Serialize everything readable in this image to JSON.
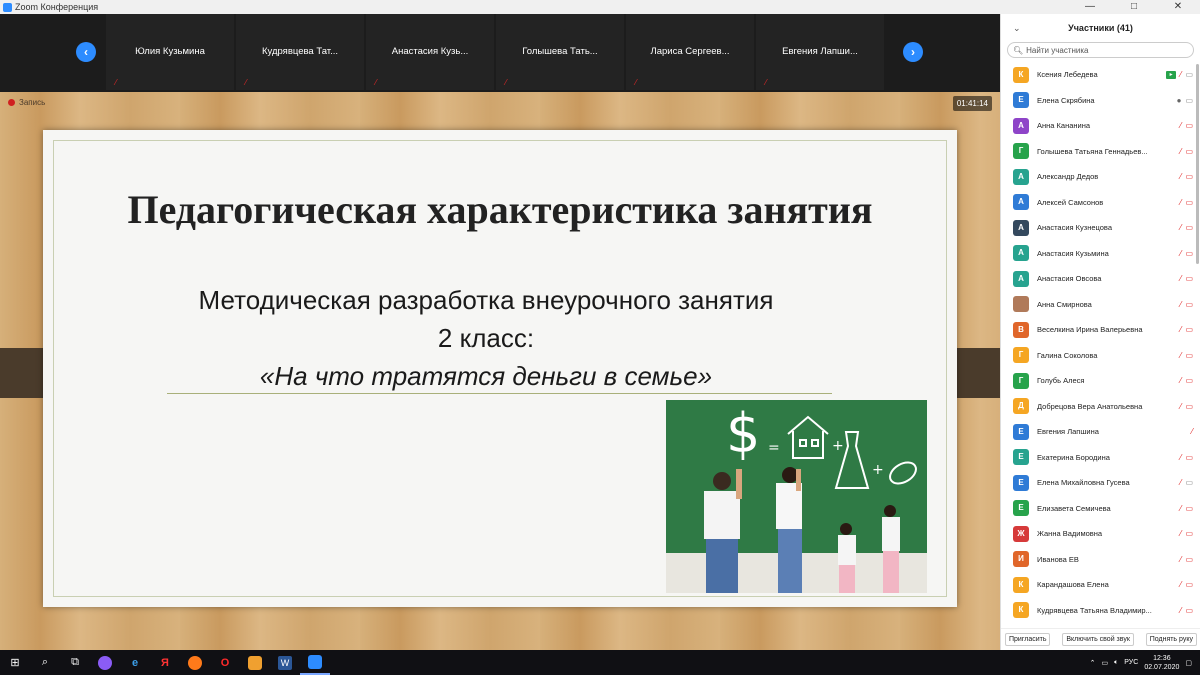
{
  "window": {
    "title": "Zoom Конференция",
    "controls": [
      "—",
      "□",
      "✕"
    ]
  },
  "strip": {
    "participants": [
      "Юлия Кузьмина",
      "Кудрявцева  Тат...",
      "Анастасия  Кузь...",
      "Голышева  Тать...",
      "Лариса  Сергеев...",
      "Евгения  Лапши..."
    ]
  },
  "share": {
    "recording_label": "Запись",
    "timer": "01:41:14"
  },
  "slide": {
    "title": "Педагогическая характеристика занятия",
    "line1": "Методическая разработка внеурочного  занятия",
    "line2": "2 класс:",
    "line3": "«На что тратятся  деньги в семье»"
  },
  "panel": {
    "title": "Участники (41)",
    "search_placeholder": "Найти участника",
    "participants": [
      {
        "initial": "К",
        "name": "Ксения Лебедева",
        "color": "#f5a623",
        "icons": "share-mic-cam"
      },
      {
        "initial": "Е",
        "name": "Елена Скрябина",
        "color": "#2f7bd6",
        "icons": "mic-cam"
      },
      {
        "initial": "А",
        "name": " Анна Кананина",
        "color": "#8e44c8",
        "icons": "off"
      },
      {
        "initial": "Г",
        "name": " Голышева Татьяна Геннадьев...",
        "color": "#27a34b",
        "icons": "off"
      },
      {
        "initial": "А",
        "name": "Александр Дедов",
        "color": "#27a38f",
        "icons": "off"
      },
      {
        "initial": "А",
        "name": "Алексей Самсонов",
        "color": "#2f7bd6",
        "icons": "off"
      },
      {
        "initial": "А",
        "name": "Анастасия Кузнецова",
        "color": "#34495e",
        "icons": "off"
      },
      {
        "initial": "А",
        "name": "Анастасия Кузьмина",
        "color": "#27a38f",
        "icons": "off"
      },
      {
        "initial": "А",
        "name": "Анастасия Овсова",
        "color": "#27a38f",
        "icons": "off"
      },
      {
        "initial": "",
        "name": "Анна Смирнова",
        "color": "#b07a5a",
        "icons": "off"
      },
      {
        "initial": "В",
        "name": "Веселкина Ирина Валерьевна",
        "color": "#e0662a",
        "icons": "off"
      },
      {
        "initial": "Г",
        "name": "Галина Соколова",
        "color": "#f5a623",
        "icons": "off"
      },
      {
        "initial": "Г",
        "name": "Голубь Алеся",
        "color": "#27a34b",
        "icons": "off"
      },
      {
        "initial": "Д",
        "name": "Добрецова Вера Анатольевна",
        "color": "#f5a623",
        "icons": "off"
      },
      {
        "initial": "Е",
        "name": "Евгения Лапшина",
        "color": "#2f7bd6",
        "icons": "mic-off"
      },
      {
        "initial": "Е",
        "name": "Екатерина Бородина",
        "color": "#27a38f",
        "icons": "off"
      },
      {
        "initial": "Е",
        "name": "Елена Михайловна Гусева",
        "color": "#2f7bd6",
        "icons": "mic-off-cam"
      },
      {
        "initial": "Е",
        "name": "Елизавета Семичева",
        "color": "#27a34b",
        "icons": "off"
      },
      {
        "initial": "Ж",
        "name": "Жанна Вадимовна",
        "color": "#d63a3a",
        "icons": "off"
      },
      {
        "initial": "И",
        "name": "Иванова ЕВ",
        "color": "#e0662a",
        "icons": "off"
      },
      {
        "initial": "К",
        "name": "Карандашова Елена",
        "color": "#f5a623",
        "icons": "off"
      },
      {
        "initial": "К",
        "name": "Кудрявцева Татьяна Владимир...",
        "color": "#f5a623",
        "icons": "off"
      }
    ],
    "footer": {
      "invite": "Пригласить",
      "unmute": "Включить свой звук",
      "raise_hand": "Поднять руку"
    }
  },
  "taskbar": {
    "tray_lang": "РУС",
    "time": "12:36",
    "date": "02.07.2020"
  }
}
